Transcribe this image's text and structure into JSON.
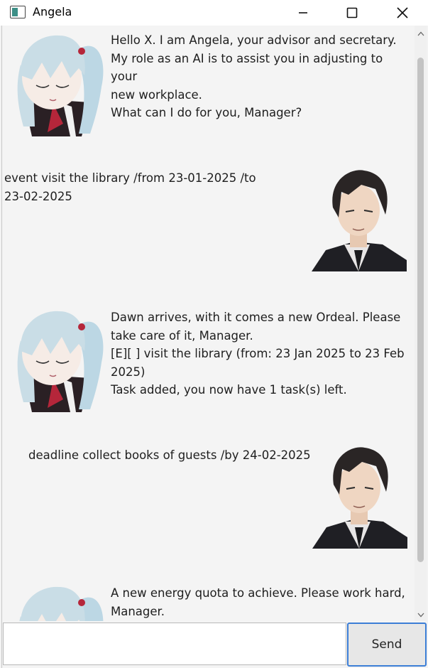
{
  "window": {
    "title": "Angela",
    "controls": {
      "minimize": "minimize-icon",
      "maximize": "maximize-icon",
      "close": "close-icon"
    }
  },
  "chat": {
    "messages": [
      {
        "sender": "Angela",
        "avatar": "angela-avatar",
        "text": "Hello X. I am Angela, your advisor and secretary.\nMy role as an AI is to assist you in adjusting to your\nnew workplace.\nWhat can I do for you, Manager?"
      },
      {
        "sender": "user",
        "avatar": "manager-avatar",
        "text": "event visit the library /from 23-01-2025 /to\n23-02-2025"
      },
      {
        "sender": "Angela",
        "avatar": "angela-avatar",
        "text": "Dawn arrives, with it comes a new Ordeal. Please\ntake care of it, Manager.\n[E][ ] visit the library (from: 23 Jan 2025 to 23 Feb\n2025)\nTask added, you now have 1 task(s) left."
      },
      {
        "sender": "user",
        "avatar": "manager-avatar",
        "text": "deadline collect books of guests /by 24-02-2025"
      },
      {
        "sender": "Angela",
        "avatar": "angela-avatar",
        "text": "A new energy quota to achieve. Please work hard,\nManager."
      }
    ]
  },
  "input": {
    "value": "",
    "placeholder": ""
  },
  "send_button": {
    "label": "Send"
  },
  "colors": {
    "accent": "#3c7ed6",
    "angela_hair": "#c9dde6",
    "manager_hair": "#2a2525",
    "suit": "#1f1f24"
  }
}
